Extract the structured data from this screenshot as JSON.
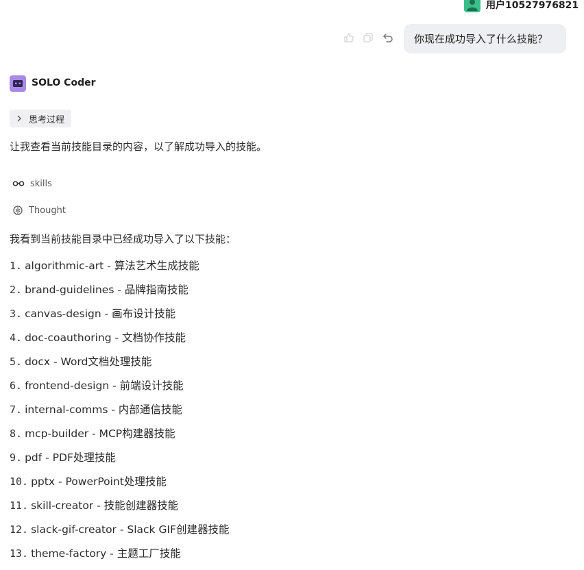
{
  "header": {
    "user_name": "用户10527976821"
  },
  "user_message": {
    "text": "你现在成功导入了什么技能？",
    "icons": [
      "like-icon",
      "copy-icon",
      "undo-icon"
    ]
  },
  "assistant": {
    "name": "SOLO Coder",
    "think_label": "思考过程",
    "intro": "让我查看当前技能目录的内容，以了解成功导入的技能。",
    "tool_label": "skills",
    "thought_label": "Thought",
    "summary": "我看到当前技能目录中已经成功导入了以下技能：",
    "skills": [
      {
        "num": "1.",
        "name": "algorithmic-art",
        "desc": "算法艺术生成技能"
      },
      {
        "num": "2.",
        "name": "brand-guidelines",
        "desc": "品牌指南技能"
      },
      {
        "num": "3.",
        "name": "canvas-design",
        "desc": "画布设计技能"
      },
      {
        "num": "4.",
        "name": "doc-coauthoring",
        "desc": "文档协作技能"
      },
      {
        "num": "5.",
        "name": "docx",
        "desc": "Word文档处理技能"
      },
      {
        "num": "6.",
        "name": "frontend-design",
        "desc": "前端设计技能"
      },
      {
        "num": "7.",
        "name": "internal-comms",
        "desc": "内部通信技能"
      },
      {
        "num": "8.",
        "name": "mcp-builder",
        "desc": "MCP构建器技能"
      },
      {
        "num": "9.",
        "name": "pdf",
        "desc": "PDF处理技能"
      },
      {
        "num": "10.",
        "name": "pptx",
        "desc": "PowerPoint处理技能"
      },
      {
        "num": "11.",
        "name": "skill-creator",
        "desc": "技能创建器技能"
      },
      {
        "num": "12.",
        "name": "slack-gif-creator",
        "desc": "Slack GIF创建器技能"
      },
      {
        "num": "13.",
        "name": "theme-factory",
        "desc": "主题工厂技能"
      }
    ]
  },
  "colors": {
    "user_avatar": "#3bbf8a",
    "bot_avatar": "#a98be6",
    "bubble_bg": "#eeeff2",
    "think_bg": "#f0f0f2"
  }
}
